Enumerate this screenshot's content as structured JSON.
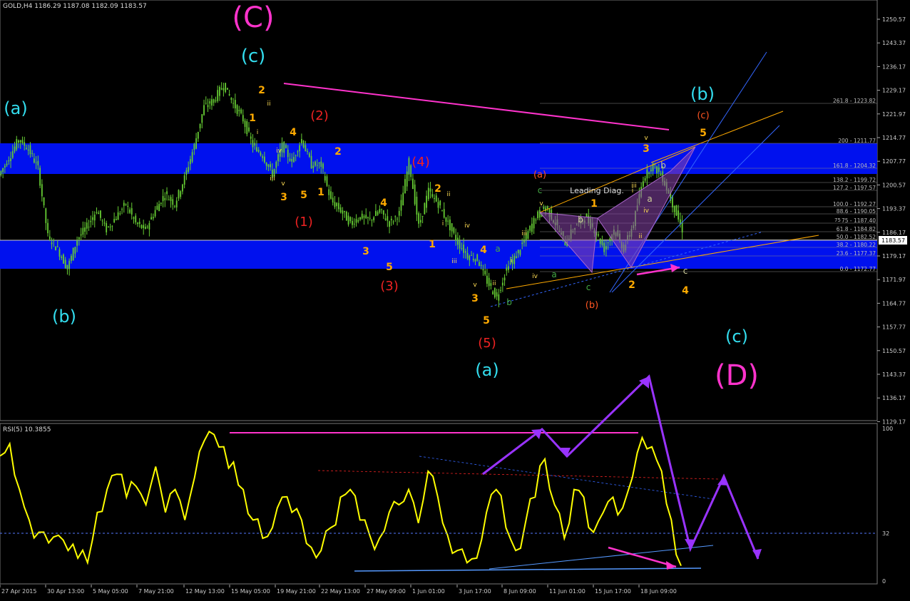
{
  "header": {
    "symbol_line": "GOLD,H4  1186.29 1187.08 1182.09 1183.57",
    "current_price": "1183.57",
    "rsi_label": "RSI(5) 10.3855"
  },
  "price_axis_labels": [
    "1250.57",
    "1243.37",
    "1236.17",
    "1229.17",
    "1221.97",
    "1214.77",
    "1207.77",
    "1200.57",
    "1193.37",
    "1186.17",
    "1179.17",
    "1171.97",
    "1164.77",
    "1157.77",
    "1150.57",
    "1143.37",
    "1136.17",
    "1129.17"
  ],
  "rsi_axis_labels": [
    "100",
    "32",
    "0"
  ],
  "time_axis_labels": [
    "27 Apr 2015",
    "30 Apr 13:00",
    "5 May 05:00",
    "7 May 21:00",
    "12 May 13:00",
    "15 May 05:00",
    "19 May 21:00",
    "22 May 13:00",
    "27 May 09:00",
    "1 Jun 01:00",
    "3 Jun 17:00",
    "8 Jun 09:00",
    "11 Jun 01:00",
    "15 Jun 17:00",
    "18 Jun 09:00"
  ],
  "fib_levels": [
    "261.8 - 1223.82",
    "200 - 1211.77",
    "161.8 - 1204.32",
    "138.2 - 1199.72",
    "127.2 - 1197.57",
    "100.0 - 1192.27",
    "88.6 - 1190.05",
    "75 - 1187.40",
    "61.8 - 1184.82",
    "50.0 - 1182.52",
    "38.2 - 1180.22",
    "23.6 - 1177.37",
    "0.0 - 1172.77"
  ],
  "fib_small_label": "75",
  "pattern_label": "Leading Diag.",
  "wave_labels": {
    "C_major": "(C)",
    "D_major": "(D)",
    "c_cyan_top": "(c)",
    "a_cyan": "(a)",
    "b_cyan_low": "(b)",
    "a_cyan_bottom": "(a)",
    "b_cyan_right": "(b)",
    "c_cyan_right": "(c)",
    "r1": "(1)",
    "r2": "(2)",
    "r3": "(3)",
    "r4": "(4)",
    "r5": "(5)",
    "a_small": "(a)",
    "b_small": "(b)",
    "c_small": "(c)"
  },
  "minor_labels": {
    "digits": [
      "1",
      "2",
      "3",
      "4",
      "5"
    ],
    "roman": [
      "i",
      "ii",
      "iii",
      "iv",
      "v"
    ],
    "letters": [
      "a",
      "b",
      "c"
    ]
  },
  "colors": {
    "background": "#000000",
    "candles": "#66cc33",
    "blue_zone": "#0011ee",
    "rsi_line": "#ffff00",
    "magenta": "#ff33cc",
    "cyan": "#33ddee",
    "orange": "#ffaa00",
    "red_label": "#ee2222",
    "purple_arrow": "#9933ff",
    "fib_line": "#888888"
  },
  "chart_data": [
    {
      "type": "candlestick",
      "title": "GOLD,H4",
      "ylim": [
        1125,
        1255
      ],
      "close_path": [
        1201,
        1206,
        1212,
        1209,
        1203,
        1182,
        1178,
        1172,
        1181,
        1185,
        1190,
        1184,
        1188,
        1192,
        1186,
        1184,
        1190,
        1195,
        1192,
        1200,
        1210,
        1222,
        1224,
        1229,
        1223,
        1218,
        1210,
        1207,
        1201,
        1210,
        1205,
        1212,
        1204,
        1204,
        1193,
        1190,
        1186,
        1188,
        1187,
        1190,
        1186,
        1189,
        1205,
        1185,
        1196,
        1192,
        1186,
        1180,
        1176,
        1175,
        1168,
        1163,
        1172,
        1176,
        1182,
        1188,
        1191,
        1186,
        1180,
        1185,
        1188,
        1184,
        1178,
        1184,
        1178,
        1186,
        1200,
        1204,
        1200,
        1192,
        1184
      ],
      "annotations": [
        "Leading Diag.",
        "(C)",
        "(D)"
      ]
    },
    {
      "type": "line",
      "title": "RSI(5) 10.3855",
      "ylim": [
        0,
        100
      ],
      "reference_level": 32,
      "values": [
        82,
        90,
        60,
        40,
        32,
        25,
        30,
        20,
        15,
        12,
        45,
        60,
        70,
        55,
        62,
        50,
        75,
        45,
        60,
        40,
        68,
        92,
        96,
        88,
        78,
        60,
        40,
        28,
        35,
        55,
        45,
        40,
        22,
        20,
        35,
        55,
        60,
        40,
        30,
        28,
        45,
        50,
        60,
        38,
        72,
        55,
        30,
        20,
        12,
        15,
        45,
        60,
        35,
        20,
        38,
        55,
        80,
        50,
        28,
        60,
        55,
        32,
        45,
        55,
        48,
        68,
        94,
        88,
        72,
        40,
        10
      ],
      "ticks": [
        "27 Apr 2015",
        "30 Apr 13:00",
        "5 May 05:00",
        "7 May 21:00",
        "12 May 13:00",
        "15 May 05:00",
        "19 May 21:00",
        "22 May 13:00",
        "27 May 09:00",
        "1 Jun 01:00",
        "3 Jun 17:00",
        "8 Jun 09:00",
        "11 Jun 01:00",
        "15 Jun 17:00",
        "18 Jun 09:00"
      ]
    }
  ]
}
